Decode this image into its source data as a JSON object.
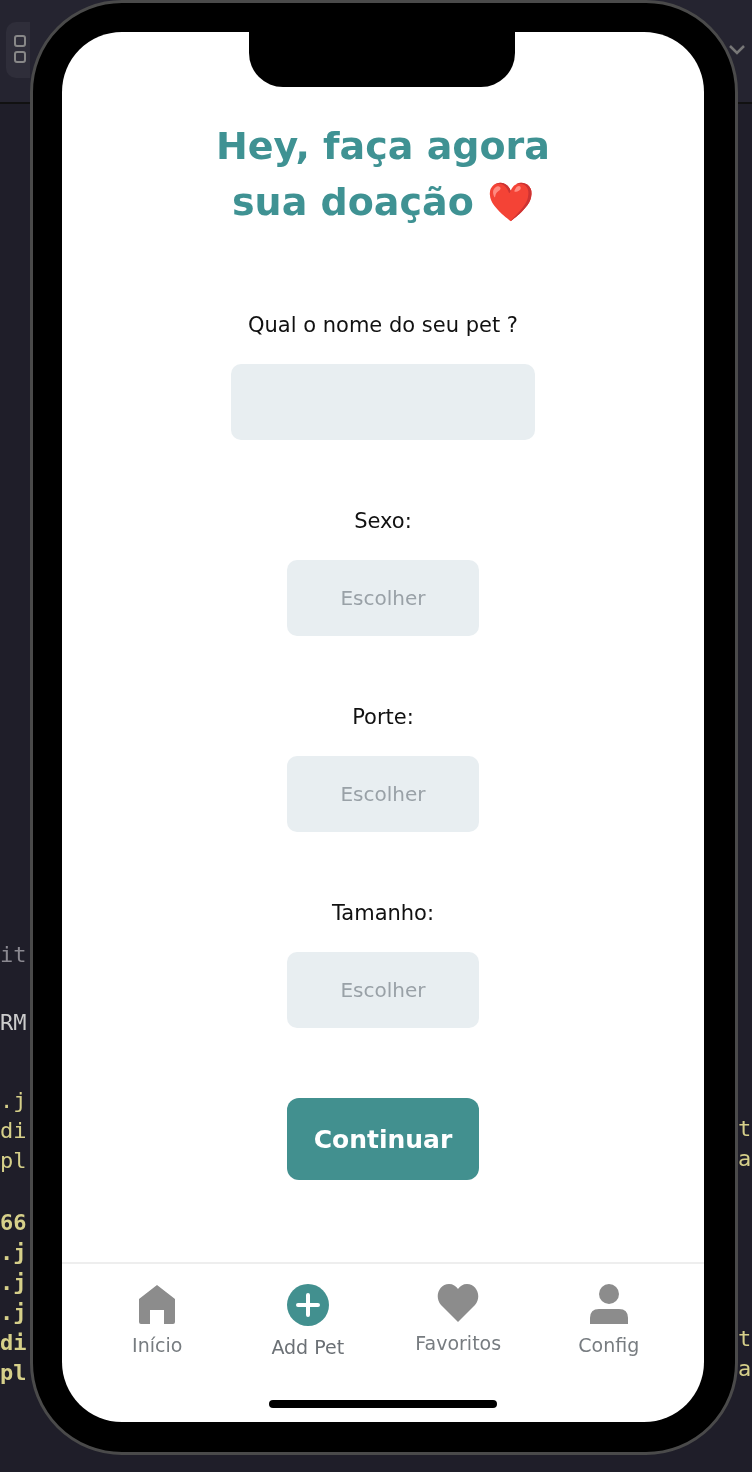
{
  "editor_background": {
    "left_fragments": [
      [
        "it"
      ],
      [
        "RM"
      ],
      [
        ".j",
        "di",
        "pl"
      ],
      [
        "66",
        ".j",
        ".j",
        ".j",
        "di",
        "pl"
      ]
    ],
    "right_fragments": [
      [
        "t",
        "a"
      ],
      [
        "t",
        "a"
      ]
    ]
  },
  "title": {
    "lines": [
      "Hey, faça agora",
      "sua doação"
    ],
    "emoji": "❤️"
  },
  "form": [
    {
      "kind": "text",
      "label": "Qual o nome do seu pet ?"
    },
    {
      "kind": "select",
      "label": "Sexo:",
      "placeholder": "Escolher"
    },
    {
      "kind": "select",
      "label": "Porte:",
      "placeholder": "Escolher"
    },
    {
      "kind": "select",
      "label": "Tamanho:",
      "placeholder": "Escolher"
    }
  ],
  "submit": "Continuar",
  "tabs": [
    {
      "kind": "home",
      "label": "Início",
      "selected": false
    },
    {
      "kind": "add",
      "label": "Add Pet",
      "selected": true
    },
    {
      "kind": "heart",
      "label": "Favoritos",
      "selected": false
    },
    {
      "kind": "user",
      "label": "Config",
      "selected": false
    }
  ]
}
